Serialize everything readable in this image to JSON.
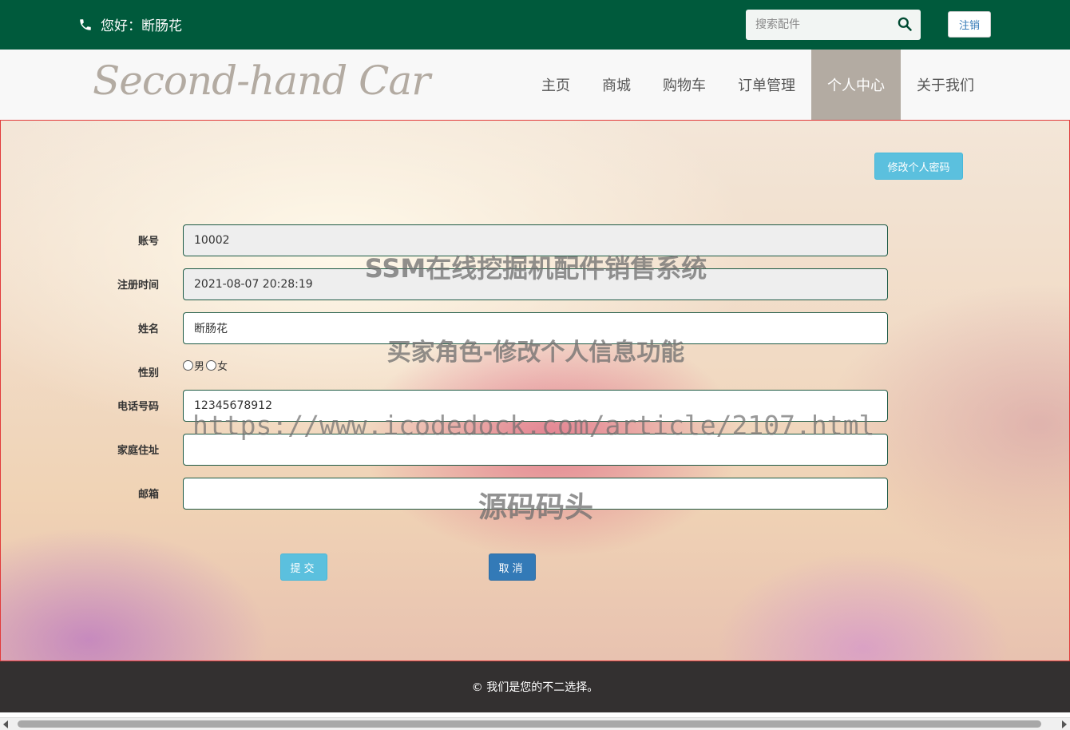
{
  "header": {
    "greeting": "您好：断肠花",
    "search_placeholder": "搜索配件",
    "logout_label": "注销",
    "bg_color": "#005a3c"
  },
  "navbar": {
    "logo_text": "Second-hand Car",
    "items": [
      {
        "label": "主页"
      },
      {
        "label": "商城"
      },
      {
        "label": "购物车"
      },
      {
        "label": "订单管理"
      },
      {
        "label": "个人中心",
        "active": true
      },
      {
        "label": "关于我们"
      }
    ]
  },
  "profile": {
    "change_password_label": "修改个人密码",
    "fields": {
      "account": {
        "label": "账号",
        "value": "10002"
      },
      "register_time": {
        "label": "注册时间",
        "value": "2021-08-07 20:28:19"
      },
      "name": {
        "label": "姓名",
        "value": "断肠花"
      },
      "gender": {
        "label": "性别",
        "options": [
          "男",
          "女"
        ]
      },
      "phone": {
        "label": "电话号码",
        "value": "12345678912"
      },
      "address": {
        "label": "家庭住址",
        "value": ""
      },
      "email": {
        "label": "邮箱",
        "value": ""
      }
    },
    "submit_label": "提交",
    "cancel_label": "取消"
  },
  "watermarks": {
    "line1": "SSM在线挖掘机配件销售系统",
    "line2": "买家角色-修改个人信息功能",
    "line3": "https://www.icodedock.com/article/2107.html",
    "line4": "源码码头"
  },
  "footer": {
    "text": "© 我们是您的不二选择。"
  }
}
